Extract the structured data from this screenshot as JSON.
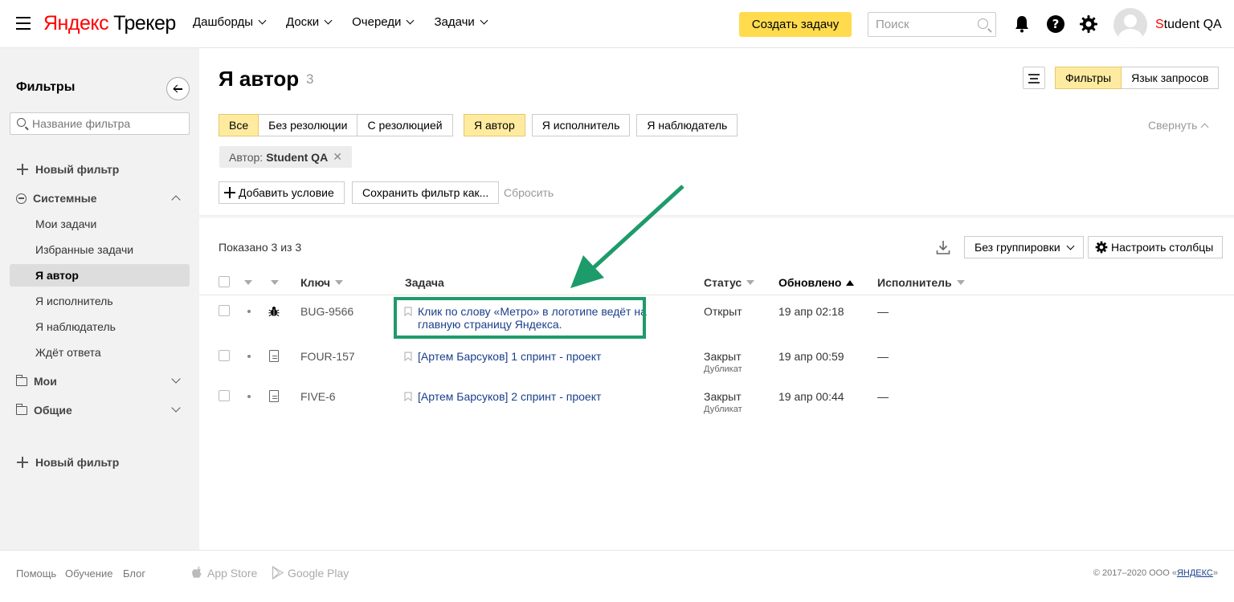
{
  "header": {
    "logo_brand": "Яндекс",
    "logo_product": "Трекер",
    "nav": [
      "Дашборды",
      "Доски",
      "Очереди",
      "Задачи"
    ],
    "create_button": "Создать задачу",
    "search_placeholder": "Поиск",
    "user_first_letter": "S",
    "user_rest": "tudent QA"
  },
  "sidebar": {
    "title": "Фильтры",
    "search_placeholder": "Название фильтра",
    "new_filter": "Новый фильтр",
    "system_group": "Системные",
    "system_items": [
      "Мои задачи",
      "Избранные задачи",
      "Я автор",
      "Я исполнитель",
      "Я наблюдатель",
      "Ждёт ответа"
    ],
    "active_item": "Я автор",
    "my_group": "Мои",
    "shared_group": "Общие",
    "new_filter_bottom": "Новый фильтр"
  },
  "main": {
    "title": "Я автор",
    "count": "3",
    "mode_filters": "Фильтры",
    "mode_query": "Язык запросов",
    "resolution_tabs": [
      "Все",
      "Без резолюции",
      "С резолюцией"
    ],
    "role_tabs": [
      "Я автор",
      "Я исполнитель",
      "Я наблюдатель"
    ],
    "collapse": "Свернуть",
    "chip_label": "Автор:",
    "chip_value": "Student QA",
    "chip_close": "✕",
    "add_condition": "Добавить условие",
    "save_filter": "Сохранить фильтр как...",
    "reset": "Сбросить",
    "shown": "Показано 3 из 3",
    "grouping": "Без группировки",
    "configure_columns": "Настроить столбцы"
  },
  "table": {
    "columns": {
      "key": "Ключ",
      "task": "Задача",
      "status": "Статус",
      "updated": "Обновлено",
      "assignee": "Исполнитель"
    },
    "rows": [
      {
        "key": "BUG-9566",
        "type": "bug-icon",
        "task_line1": "Клик по слову «Метро» в логотипе ведёт на",
        "task_line2": "главную страницу Яндекса.",
        "status": "Открыт",
        "resolution": "",
        "updated": "19 апр 02:18",
        "assignee": "—"
      },
      {
        "key": "FOUR-157",
        "type": "task-icon",
        "task_line1": "[Артем Барсуков] 1 спринт - проект",
        "task_line2": "",
        "status": "Закрыт",
        "resolution": "Дубликат",
        "updated": "19 апр 00:59",
        "assignee": "—"
      },
      {
        "key": "FIVE-6",
        "type": "task-icon",
        "task_line1": "[Артем Барсуков] 2 спринт - проект",
        "task_line2": "",
        "status": "Закрыт",
        "resolution": "Дубликат",
        "updated": "19 апр 00:44",
        "assignee": "—"
      }
    ]
  },
  "footer": {
    "links": [
      "Помощь",
      "Обучение",
      "Блог"
    ],
    "app_store": "App Store",
    "google_play": "Google Play",
    "copyright_prefix": "© 2017–2020  ООО «",
    "copyright_link": "ЯНДЕКС",
    "copyright_suffix": "»"
  },
  "colors": {
    "accent_yellow": "#ffdb4d",
    "highlight_green": "#1e9b6a",
    "link_blue": "#1a3f8c"
  }
}
